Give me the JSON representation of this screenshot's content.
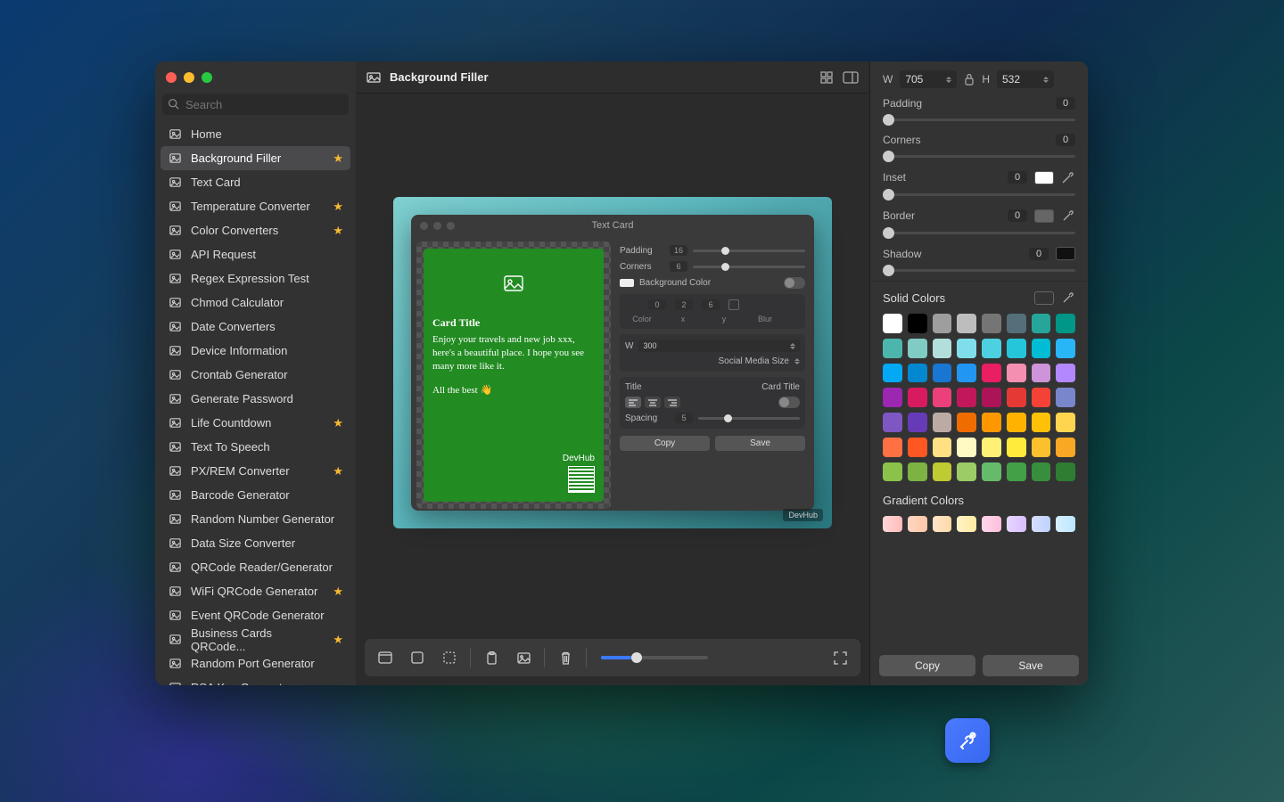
{
  "window": {
    "title": "Background Filler"
  },
  "search": {
    "placeholder": "Search"
  },
  "sidebar": {
    "items": [
      {
        "label": "Home",
        "star": false,
        "active": false
      },
      {
        "label": "Background Filler",
        "star": true,
        "active": true
      },
      {
        "label": "Text Card",
        "star": false,
        "active": false
      },
      {
        "label": "Temperature Converter",
        "star": true,
        "active": false
      },
      {
        "label": "Color Converters",
        "star": true,
        "active": false
      },
      {
        "label": "API Request",
        "star": false,
        "active": false
      },
      {
        "label": "Regex Expression Test",
        "star": false,
        "active": false
      },
      {
        "label": "Chmod Calculator",
        "star": false,
        "active": false
      },
      {
        "label": "Date Converters",
        "star": false,
        "active": false
      },
      {
        "label": "Device Information",
        "star": false,
        "active": false
      },
      {
        "label": "Crontab Generator",
        "star": false,
        "active": false
      },
      {
        "label": "Generate Password",
        "star": false,
        "active": false
      },
      {
        "label": "Life Countdown",
        "star": true,
        "active": false
      },
      {
        "label": "Text To Speech",
        "star": false,
        "active": false
      },
      {
        "label": "PX/REM Converter",
        "star": true,
        "active": false
      },
      {
        "label": "Barcode Generator",
        "star": false,
        "active": false
      },
      {
        "label": "Random Number Generator",
        "star": false,
        "active": false
      },
      {
        "label": "Data Size Converter",
        "star": false,
        "active": false
      },
      {
        "label": "QRCode Reader/Generator",
        "star": false,
        "active": false
      },
      {
        "label": "WiFi QRCode Generator",
        "star": true,
        "active": false
      },
      {
        "label": "Event QRCode Generator",
        "star": false,
        "active": false
      },
      {
        "label": "Business Cards QRCode...",
        "star": true,
        "active": false
      },
      {
        "label": "Random Port Generator",
        "star": false,
        "active": false
      },
      {
        "label": "RSA Key Generator",
        "star": false,
        "active": false
      }
    ]
  },
  "preview": {
    "inner_title": "Text Card",
    "card": {
      "title": "Card Title",
      "body": "Enjoy your travels and new job xxx, here's a beautiful place. I hope you see many more like it.",
      "signoff": "All the best 👋",
      "brand": "DevHub"
    },
    "controls": {
      "padding_label": "Padding",
      "padding_val": "16",
      "corners_label": "Corners",
      "corners_val": "6",
      "bgcolor_label": "Background Color",
      "color_label": "Color",
      "x_label": "x",
      "y_label": "y",
      "blur_label": "Blur",
      "x_val": "0",
      "y_val": "2",
      "blur_val": "6",
      "w_label": "W",
      "w_val": "300",
      "size_label": "Social Media Size",
      "title_label": "Title",
      "title_val": "Card Title",
      "spacing_label": "Spacing",
      "spacing_val": "5",
      "copy": "Copy",
      "save": "Save"
    },
    "badge": "DevHub"
  },
  "inspector": {
    "w_label": "W",
    "w_val": "705",
    "h_label": "H",
    "h_val": "532",
    "padding_label": "Padding",
    "padding_val": "0",
    "corners_label": "Corners",
    "corners_val": "0",
    "inset_label": "Inset",
    "inset_val": "0",
    "border_label": "Border",
    "border_val": "0",
    "shadow_label": "Shadow",
    "shadow_val": "0",
    "solid_label": "Solid Colors",
    "gradient_label": "Gradient Colors",
    "copy": "Copy",
    "save": "Save"
  },
  "colors": {
    "solid": [
      "#ffffff",
      "#000000",
      "#9e9e9e",
      "#bdbdbd",
      "#757575",
      "#546e7a",
      "#26a69a",
      "#009688",
      "#4db6ac",
      "#80cbc4",
      "#b2dfdb",
      "#80deea",
      "#4dd0e1",
      "#26c6da",
      "#00bcd4",
      "#29b6f6",
      "#03a9f4",
      "#0288d1",
      "#1976d2",
      "#2196f3",
      "#e91e63",
      "#f48fb1",
      "#ce93d8",
      "#b388ff",
      "#9c27b0",
      "#d81b60",
      "#ec407a",
      "#c2185b",
      "#ad1457",
      "#e53935",
      "#f44336",
      "#7986cb",
      "#7e57c2",
      "#673ab7",
      "#bcaaa4",
      "#ef6c00",
      "#ff9800",
      "#ffb300",
      "#ffc107",
      "#ffd54f",
      "#ff7043",
      "#ff5722",
      "#ffe082",
      "#fff9c4",
      "#fff176",
      "#ffeb3b",
      "#fbc02d",
      "#f9a825",
      "#8bc34a",
      "#7cb342",
      "#c0ca33",
      "#9ccc65",
      "#66bb6a",
      "#43a047",
      "#388e3c",
      "#2e7d32"
    ],
    "gradient": [
      "linear-gradient(90deg,#ffd6d6,#ffbcbc)",
      "linear-gradient(90deg,#ffd6c2,#ffc7a8)",
      "linear-gradient(90deg,#ffe6c7,#ffd9a8)",
      "linear-gradient(90deg,#fff3c7,#ffeaa0)",
      "linear-gradient(90deg,#ffd6e8,#ffbedd)",
      "linear-gradient(90deg,#e8d6ff,#d9beff)",
      "linear-gradient(90deg,#d6e0ff,#bed0ff)",
      "linear-gradient(90deg,#d6f0ff,#bee6ff)"
    ]
  }
}
